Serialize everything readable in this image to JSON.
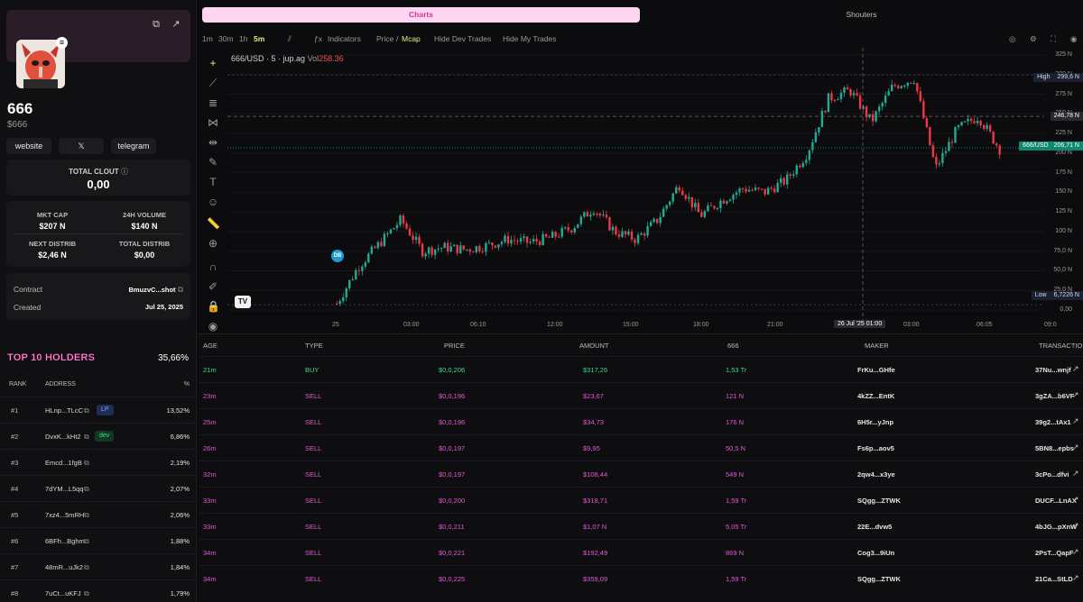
{
  "token": {
    "name": "666",
    "ticker": "$666",
    "links": [
      "website",
      "𝕏",
      "telegram"
    ]
  },
  "clout": {
    "label": "TOTAL CLOUT",
    "value": "0,00"
  },
  "stats": {
    "mkt_cap_label": "MKT CAP",
    "mkt_cap": "$207 N",
    "vol_label": "24H VOLUME",
    "vol": "$140 N",
    "next_label": "NEXT DISTRIB",
    "next": "$2,46 N",
    "total_label": "TOTAL DISTRIB",
    "total": "$0,00"
  },
  "info": {
    "contract_label": "Contract",
    "contract": "BmuzvC...shot",
    "created_label": "Created",
    "created": "Jul 25, 2025"
  },
  "holders": {
    "title": "TOP 10 HOLDERS",
    "total_pct": "35,66%",
    "headers": {
      "rank": "RANK",
      "address": "ADDRESS",
      "pct": "%"
    },
    "rows": [
      {
        "rank": "#1",
        "address": "HLnp...TLcC",
        "badge": "LP",
        "pct": "13,52%"
      },
      {
        "rank": "#2",
        "address": "DvxK...kHt2",
        "badge": "dev",
        "pct": "6,86%"
      },
      {
        "rank": "#3",
        "address": "Emcd...1fgB",
        "badge": "",
        "pct": "2,19%"
      },
      {
        "rank": "#4",
        "address": "7dYM...L5qq",
        "badge": "",
        "pct": "2,07%"
      },
      {
        "rank": "#5",
        "address": "7xz4...5mRH",
        "badge": "",
        "pct": "2,06%"
      },
      {
        "rank": "#6",
        "address": "6BFh...Bghm",
        "badge": "",
        "pct": "1,88%"
      },
      {
        "rank": "#7",
        "address": "48mR...uJk2",
        "badge": "",
        "pct": "1,84%"
      },
      {
        "rank": "#8",
        "address": "7uCt...uKFJ",
        "badge": "",
        "pct": "1,79%"
      }
    ]
  },
  "tabs": {
    "charts": "Charts",
    "shouters": "Shouters"
  },
  "toolbar": {
    "intervals": [
      "1m",
      "30m",
      "1h",
      "5m"
    ],
    "active_interval": "5m",
    "indicators": "Indicators",
    "price": "Price",
    "slash": "/",
    "mcap": "Mcap",
    "hide_dev": "Hide Dev Trades",
    "hide_my": "Hide My Trades"
  },
  "chart": {
    "symbol": "666/USD · 5 · jup.ag",
    "vol_label": "Vol",
    "vol_value": "258.36",
    "y_ticks": [
      "325 N",
      "300 N",
      "275 N",
      "250 N",
      "225 N",
      "200 N",
      "175 N",
      "150 N",
      "125 N",
      "100 N",
      "75,0 N",
      "50,0 N",
      "25,0 N",
      "0,00"
    ],
    "x_ticks": [
      "25",
      "03:00",
      "06:10",
      "12:00",
      "15:00",
      "18:00",
      "21:00",
      "26 Jul '25  01:00",
      "03:00",
      "06:05",
      "09:0"
    ],
    "high_label": "High",
    "high_value": "299,6 N",
    "crosshair_value": "246,78 N",
    "pair_label": "666/USD",
    "last_value": "206,71 N",
    "low_label": "Low",
    "low_value": "6,7226 N",
    "dev_marker": "DB",
    "tv_logo": "TV"
  },
  "colors": {
    "up": "#22ab94",
    "down": "#f23645",
    "accent": "#ffd6f2",
    "buy": "#3ddc84",
    "sell": "#e25ad6"
  },
  "chart_data": {
    "type": "candlestick",
    "title": "",
    "xlabel": "",
    "ylabel": "",
    "ylim": [
      0,
      325
    ],
    "unit": "N",
    "summary": {
      "high": 299.6,
      "low": 6.7226,
      "last": 206.71
    },
    "close_path": [
      [
        0,
        8
      ],
      [
        1,
        55
      ],
      [
        2,
        85
      ],
      [
        3,
        115
      ],
      [
        4,
        75
      ],
      [
        5,
        80
      ],
      [
        6,
        77
      ],
      [
        7,
        82
      ],
      [
        8,
        90
      ],
      [
        9,
        86
      ],
      [
        10,
        92
      ],
      [
        11,
        105
      ],
      [
        12,
        130
      ],
      [
        13,
        100
      ],
      [
        14,
        90
      ],
      [
        15,
        115
      ],
      [
        16,
        160
      ],
      [
        17,
        120
      ],
      [
        18,
        140
      ],
      [
        19,
        155
      ],
      [
        20,
        150
      ],
      [
        21,
        165
      ],
      [
        22,
        200
      ],
      [
        23,
        270
      ],
      [
        24,
        280
      ],
      [
        25,
        240
      ],
      [
        26,
        285
      ],
      [
        27,
        295
      ],
      [
        28,
        180
      ],
      [
        29,
        230
      ],
      [
        30,
        247
      ],
      [
        31,
        205
      ]
    ]
  },
  "trades": {
    "headers": {
      "age": "AGE",
      "type": "TYPE",
      "price": "PRICE",
      "amount": "AMOUNT",
      "qty": "666",
      "maker": "MAKER",
      "tx": "TRANSACTION"
    },
    "rows": [
      {
        "age": "21m",
        "type": "BUY",
        "price": "$0,0,206",
        "amount": "$317,26",
        "qty": "1,53 Tr",
        "maker": "FrKu...GHfe",
        "tx": "37Nu...wnjf"
      },
      {
        "age": "23m",
        "type": "SELL",
        "price": "$0,0,196",
        "amount": "$23,67",
        "qty": "121 N",
        "maker": "4kZZ...EntK",
        "tx": "3gZA...b6VF"
      },
      {
        "age": "25m",
        "type": "SELL",
        "price": "$0,0,196",
        "amount": "$34,73",
        "qty": "176 N",
        "maker": "6H5r...yJnp",
        "tx": "39g2...tAx1"
      },
      {
        "age": "26m",
        "type": "SELL",
        "price": "$0,0,197",
        "amount": "$9,95",
        "qty": "50,5 N",
        "maker": "Fs6p...aov5",
        "tx": "5BN8...epbs"
      },
      {
        "age": "32m",
        "type": "SELL",
        "price": "$0,0,197",
        "amount": "$108,44",
        "qty": "549 N",
        "maker": "2qw4...x3ye",
        "tx": "3cPo...dfvi"
      },
      {
        "age": "33m",
        "type": "SELL",
        "price": "$0,0,200",
        "amount": "$318,71",
        "qty": "1,59 Tr",
        "maker": "SQgg...ZTWK",
        "tx": "DUCF...LnAX"
      },
      {
        "age": "33m",
        "type": "SELL",
        "price": "$0,0,211",
        "amount": "$1,07 N",
        "qty": "5,05 Tr",
        "maker": "22E...dvw5",
        "tx": "4bJG...pXnW"
      },
      {
        "age": "34m",
        "type": "SELL",
        "price": "$0,0,221",
        "amount": "$192,49",
        "qty": "869 N",
        "maker": "Cog3...9iUn",
        "tx": "2PsT...QapF"
      },
      {
        "age": "34m",
        "type": "SELL",
        "price": "$0,0,225",
        "amount": "$359,09",
        "qty": "1,59 Tr",
        "maker": "SQgg...ZTWK",
        "tx": "21Ca...StLD"
      }
    ]
  }
}
